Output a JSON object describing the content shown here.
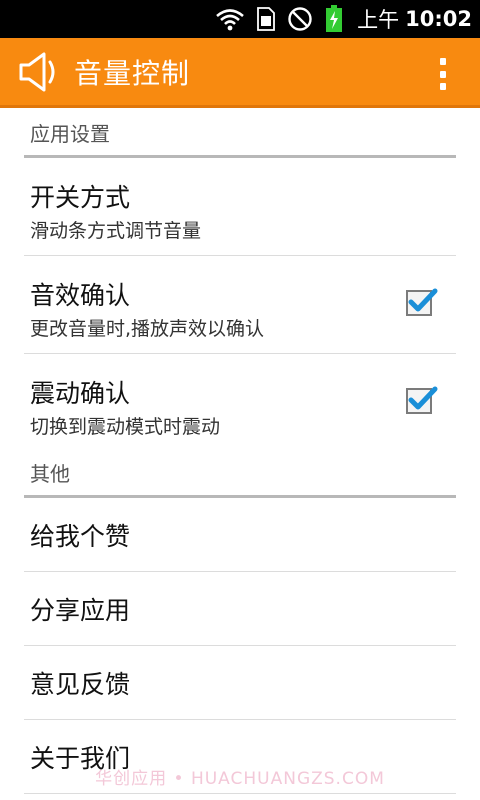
{
  "status_bar": {
    "time_prefix": "上午",
    "time": "10:02",
    "icons": [
      "wifi-icon",
      "sim-icon",
      "no-sign-icon",
      "battery-charging-icon"
    ],
    "battery_color": "#33cc33"
  },
  "action_bar": {
    "title": "音量控制",
    "icon": "speaker-icon",
    "menu_icon": "overflow-menu-icon",
    "color": "#f88a10"
  },
  "sections": [
    {
      "header": "应用设置",
      "items": [
        {
          "title": "开关方式",
          "summary": "滑动条方式调节音量"
        },
        {
          "title": "音效确认",
          "summary": "更改音量时,播放声效以确认",
          "checked": true
        },
        {
          "title": "震动确认",
          "summary": "切换到震动模式时震动",
          "checked": true
        }
      ]
    },
    {
      "header": "其他",
      "items": [
        {
          "title": "给我个赞"
        },
        {
          "title": "分享应用"
        },
        {
          "title": "意见反馈"
        },
        {
          "title": "关于我们"
        }
      ]
    }
  ],
  "watermark": "华创应用 • HUACHUANGZS.COM",
  "check_color": "#1a8fd8"
}
